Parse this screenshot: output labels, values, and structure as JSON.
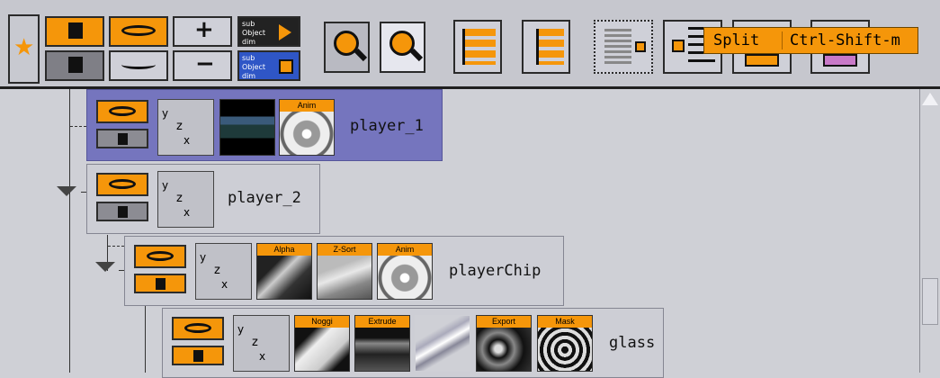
{
  "toolbar": {
    "sub_object_dim_1": "sub Object dim",
    "sub_object_dim_2": "sub Object dim",
    "tooltip": {
      "action": "Split",
      "shortcut": "Ctrl-Shift-m"
    }
  },
  "nodes": [
    {
      "label": "player_1",
      "tags": [
        "Anim"
      ]
    },
    {
      "label": "player_2",
      "tags": []
    },
    {
      "label": "playerChip",
      "tags": [
        "Alpha",
        "Z-Sort",
        "Anim"
      ]
    },
    {
      "label": "glass",
      "tags": [
        "Noggi",
        "Extrude",
        "Export",
        "Mask"
      ]
    }
  ],
  "axis_letters": {
    "y": "y",
    "z": "z",
    "x": "x"
  },
  "colors": {
    "accent": "#f5960a",
    "selected": "#7575be",
    "background": "#cfd0d6"
  }
}
